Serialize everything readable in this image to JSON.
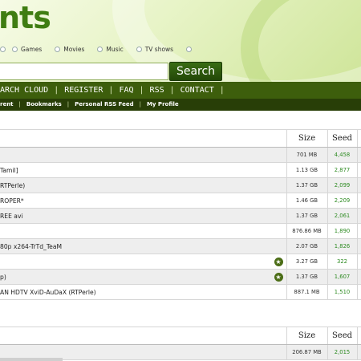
{
  "logo": {
    "text": "nts"
  },
  "categories": [
    {
      "label": ""
    },
    {
      "label": "Games"
    },
    {
      "label": "Movies"
    },
    {
      "label": "Music"
    },
    {
      "label": "TV shows"
    },
    {
      "label": ""
    }
  ],
  "search": {
    "value": "",
    "placeholder": "",
    "button_label": "Search"
  },
  "nav_main": [
    "ARCH CLOUD",
    "REGISTER",
    "FAQ",
    "RSS",
    "CONTACT",
    ""
  ],
  "nav_sub": [
    "rent",
    "Bookmarks",
    "Personal RSS Feed",
    "My Profile"
  ],
  "table1": {
    "headers": {
      "size": "Size",
      "seed": "Seed"
    },
    "rows": [
      {
        "name": "",
        "size": "701 MB",
        "seed": "4,458",
        "verified": false
      },
      {
        "name": "Tamil]",
        "size": "1.13 GB",
        "seed": "2,877",
        "verified": false
      },
      {
        "name": "RTPerle)",
        "size": "1.37 GB",
        "seed": "2,099",
        "verified": false
      },
      {
        "name": "ROPER*",
        "size": "1.46 GB",
        "seed": "2,209",
        "verified": false
      },
      {
        "name": "REE avi",
        "size": "1.37 GB",
        "seed": "2,061",
        "verified": false
      },
      {
        "name": "",
        "size": "876.86 MB",
        "seed": "1,890",
        "verified": false
      },
      {
        "name": "80p x264-TrTd_TeaM",
        "size": "2.07 GB",
        "seed": "1,826",
        "verified": false
      },
      {
        "name": "",
        "size": "3.27 GB",
        "seed": "322",
        "verified": true
      },
      {
        "name": "p)",
        "size": "1.37 GB",
        "seed": "1,607",
        "verified": true
      },
      {
        "name": "AN HDTV XviD-AuDaX (RTPerle)",
        "size": "887.1 MB",
        "seed": "1,510",
        "verified": false
      }
    ]
  },
  "table2": {
    "headers": {
      "size": "Size",
      "seed": "Seed"
    },
    "rows": [
      {
        "name": "",
        "size": "206.87 MB",
        "seed": "2,015",
        "verified": false
      }
    ]
  },
  "colors": {
    "nav_main_bg": "#3d5e0c",
    "nav_sub_bg": "#283e07",
    "seed_green": "#2e8b22",
    "logo_green": "#3f7d12"
  }
}
